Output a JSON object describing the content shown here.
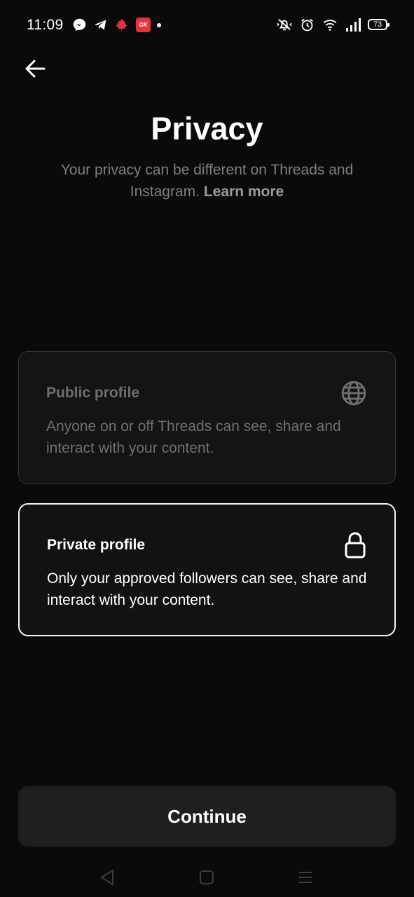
{
  "status_bar": {
    "time": "11:09",
    "app_badge": "GK",
    "battery": "73"
  },
  "header": {
    "title": "Privacy",
    "subtitle": "Your privacy can be different on Threads and Instagram.",
    "learn_more": "Learn more"
  },
  "options": [
    {
      "title": "Public profile",
      "description": "Anyone on or off Threads can see, share and interact with your content.",
      "icon": "globe-icon",
      "selected": false
    },
    {
      "title": "Private profile",
      "description": "Only your approved followers can see, share and interact with your content.",
      "icon": "lock-icon",
      "selected": true
    }
  ],
  "footer": {
    "continue_label": "Continue"
  },
  "colors": {
    "background": "#0a0a0a",
    "card_public_bg": "#141414",
    "card_selected_border": "#f5f5f5",
    "muted_text": "#7f7f7f",
    "button_bg": "#1f1f1f"
  }
}
